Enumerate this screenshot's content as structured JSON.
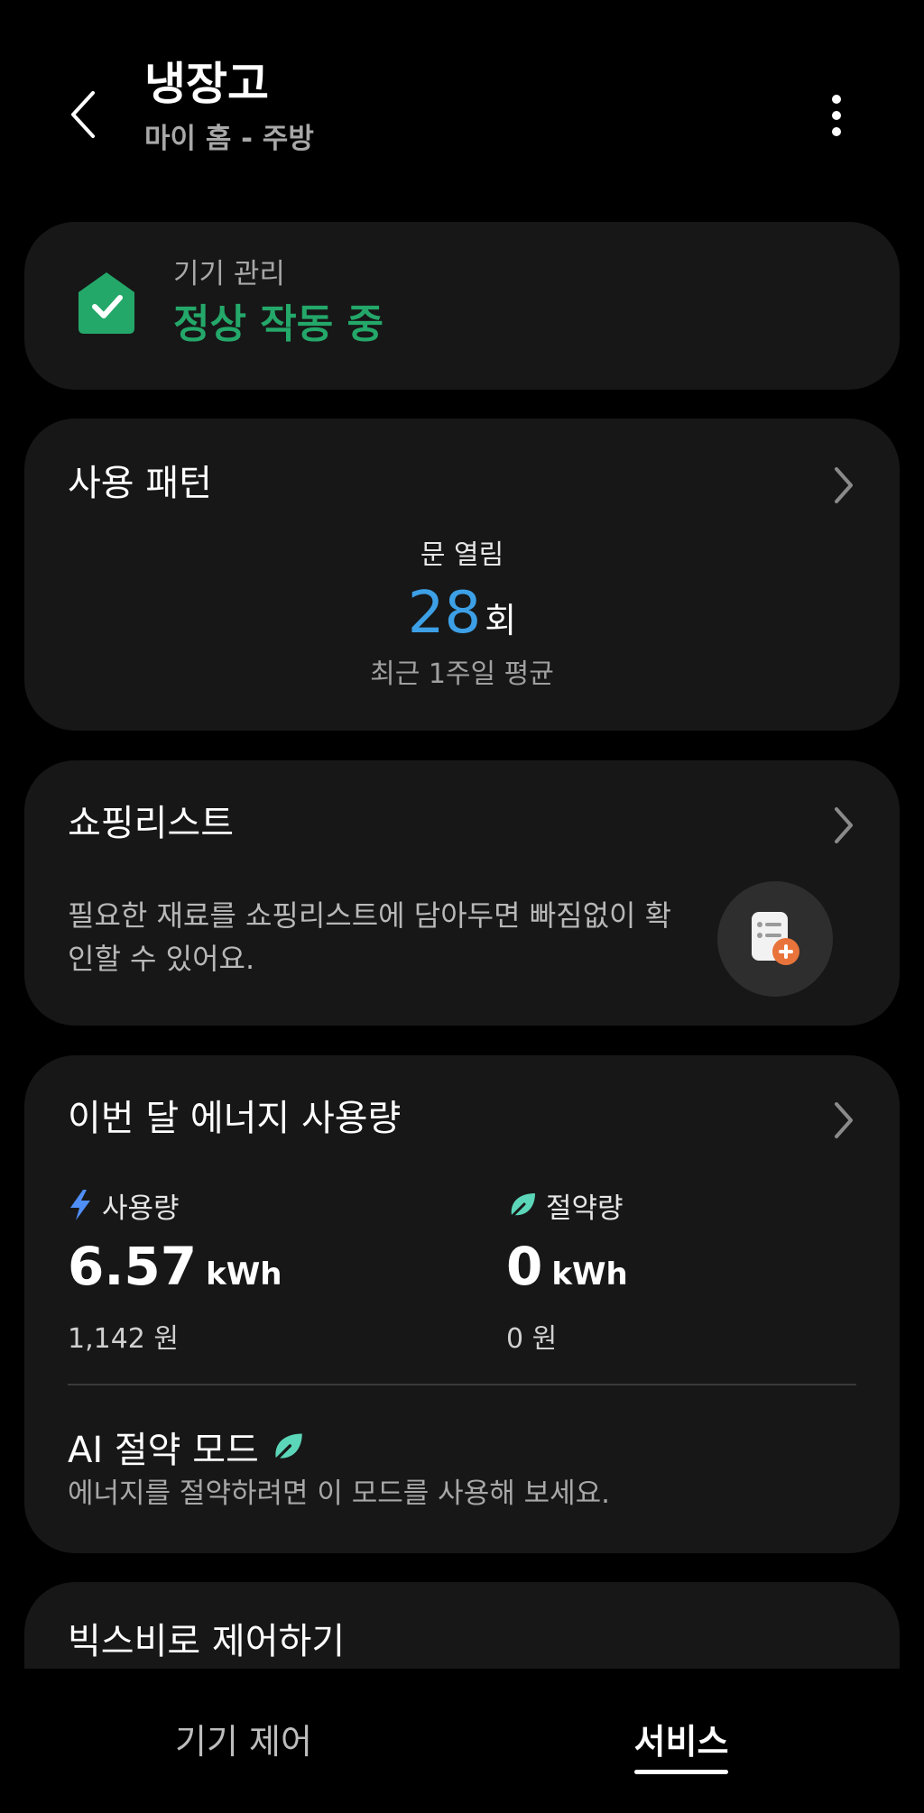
{
  "header": {
    "title": "냉장고",
    "subtitle": "마이 홈 - 주방",
    "back_icon": "chevron-left-icon",
    "more_icon": "more-vertical-icon"
  },
  "status": {
    "label": "기기 관리",
    "value": "정상 작동 중",
    "icon": "shield-check-icon",
    "color": "#24a86a"
  },
  "usage_pattern": {
    "title": "사용 패턴",
    "metric_label": "문 열림",
    "count": "28",
    "unit": "회",
    "note": "최근 1주일 평균",
    "accent": "#3da0e6"
  },
  "shopping_list": {
    "title": "쇼핑리스트",
    "description": "필요한 재료를 쇼핑리스트에 담아두면 빠짐없이 확인할 수 있어요.",
    "icon": "add-list-icon",
    "badge_color": "#e8743b"
  },
  "energy": {
    "title": "이번 달 에너지 사용량",
    "usage": {
      "label": "사용량",
      "value": "6.57",
      "unit": "kWh",
      "cost": "1,142 원",
      "icon": "lightning-icon",
      "icon_color": "#4f8ef7"
    },
    "saving": {
      "label": "절약량",
      "value": "0",
      "unit": "kWh",
      "cost": "0 원",
      "icon": "leaf-icon",
      "icon_color": "#5cd6b8"
    },
    "ai_mode": {
      "title": "AI 절약 모드",
      "description": "에너지를 절약하려면 이 모드를 사용해 보세요.",
      "icon": "leaf-icon"
    }
  },
  "bixby": {
    "title": "빅스비로 제어하기"
  },
  "bottom_nav": {
    "tabs": [
      {
        "label": "기기 제어",
        "active": false
      },
      {
        "label": "서비스",
        "active": true
      }
    ]
  }
}
